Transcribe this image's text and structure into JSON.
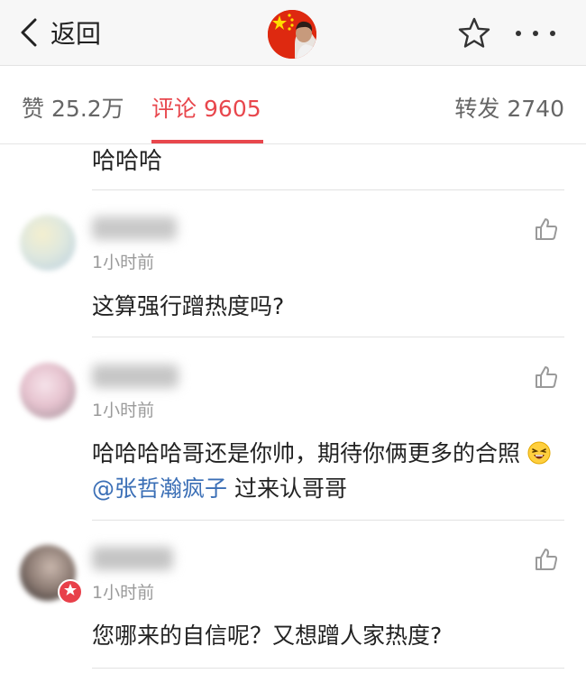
{
  "header": {
    "back_label": "返回",
    "icons": {
      "back": "chevron-left-icon",
      "favorite": "star-outline-icon",
      "more": "more-dots-icon"
    }
  },
  "tabs": {
    "likes": {
      "label": "赞",
      "count": "25.2万"
    },
    "comments": {
      "label": "评论",
      "count": "9605"
    },
    "reposts": {
      "label": "转发",
      "count": "2740"
    },
    "accent": "#e8474d"
  },
  "prev_comment_tail": "哈哈哈",
  "comments": [
    {
      "time": "1小时前",
      "text": "这算强行蹭热度吗?"
    },
    {
      "time": "1小时前",
      "text_before": "哈哈哈哈哥还是你帅，期待你俩更多的合照",
      "mention": "@张哲瀚疯子",
      "text_after": " 过来认哥哥"
    },
    {
      "time": "1小时前",
      "text": "您哪来的自信呢？又想蹭人家热度?"
    }
  ]
}
